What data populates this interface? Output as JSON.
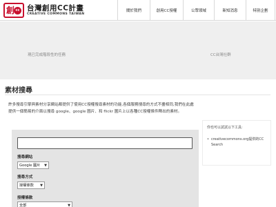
{
  "header": {
    "logo_title": "台灣創用CC計畫",
    "logo_subtitle": "CREATIVE COMMONS TAIWAN",
    "logo_glyph": "創",
    "logo_cc": "cc",
    "nav": [
      "關於我們",
      "創用CC授權",
      "公眾領域",
      "新知消息",
      "特別企劃"
    ]
  },
  "banner": {
    "left_link": "現已完成階段性的任務",
    "right_link": "CC台灣社群"
  },
  "page": {
    "title": "素材搜尋",
    "intro": "許多搜尋引擎與素材分享網站都提供了使用CC授權搜尋素材的功能,各個服務搜尋的方式不盡相同,我們在此處提供一個簡易的介面以搜尋 google、google 圖片、和 flickr 圖片上以各種CC授權條件釋出的素材。"
  },
  "sidebar": {
    "title": "你也可以試試以下工具:",
    "items": [
      {
        "bullet": "•",
        "label": "creativecommons.org提供的CC Search"
      }
    ]
  },
  "search": {
    "input_value": "",
    "engine_label": "搜尋網站",
    "engine_selected": "Google 圖片",
    "method_label": "搜尋方式",
    "method_selected": "授權條款",
    "condition_label": "授權條款",
    "condition_selected": "全部",
    "arrow": "▼"
  },
  "colors": {
    "brand_red": "#c8102e",
    "banner_grey": "#efefef",
    "panel_grey": "#e4e4e4"
  }
}
